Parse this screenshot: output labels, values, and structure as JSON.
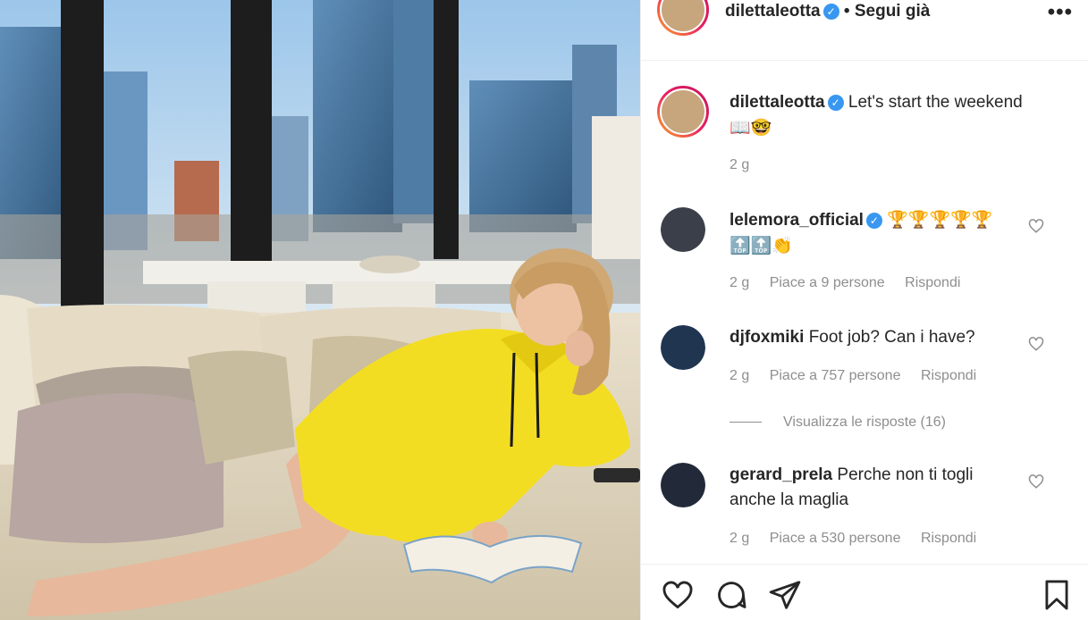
{
  "post": {
    "username": "dilettaleotta",
    "separator": "•",
    "follow_status": "Segui già",
    "more_label": "•••",
    "caption": "Let's start the weekend",
    "caption_emoji": "📖🤓",
    "time": "2 g"
  },
  "comments": [
    {
      "username": "lelemora_official",
      "verified": true,
      "text": "🏆🏆🏆🏆🏆🔝🔝👏",
      "time": "2 g",
      "likes": "Piace a 9 persone",
      "reply": "Rispondi"
    },
    {
      "username": "djfoxmiki",
      "verified": false,
      "text": "Foot job? Can i have?",
      "time": "2 g",
      "likes": "Piace a 757 persone",
      "reply": "Rispondi",
      "view_replies": "Visualizza le risposte (16)"
    },
    {
      "username": "gerard_prela",
      "verified": false,
      "text": "Perche non ti togli anche la maglia",
      "time": "2 g",
      "likes": "Piace a 530 persone",
      "reply": "Rispondi"
    }
  ],
  "icons": [
    "heart-icon",
    "comment-icon",
    "share-icon",
    "bookmark-icon",
    "verified-icon",
    "more-icon"
  ],
  "colors": {
    "verified": "#3897f0",
    "muted": "#8e8e8e",
    "text": "#262626",
    "sweater": "#f3dd22"
  }
}
